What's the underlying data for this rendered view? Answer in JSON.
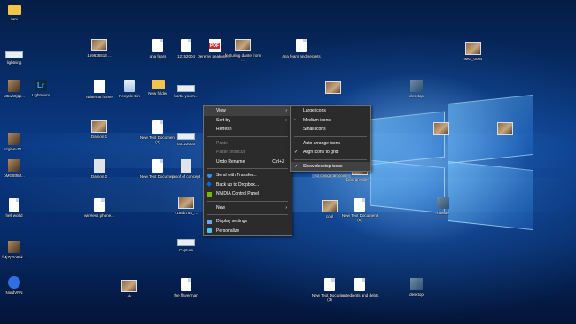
{
  "desktop": {
    "icons": [
      {
        "label": "funi",
        "kind": "folder"
      },
      {
        "label": "lightning",
        "kind": "strip"
      },
      {
        "label": "159635513 ...",
        "kind": "img"
      },
      {
        "label": "ana fears",
        "kind": "file"
      },
      {
        "label": "12152004",
        "kind": "file"
      },
      {
        "label": "Jeremy Leakone...",
        "kind": "pdf"
      },
      {
        "label": "featuring dante from ...",
        "kind": "img"
      },
      {
        "label": "ana fears and secrets",
        "kind": "file"
      },
      {
        "label": "IMG_0064",
        "kind": "img"
      },
      {
        "label": "ut5wh9jzp...",
        "kind": "photo"
      },
      {
        "label": "Lightroom",
        "kind": "lr"
      },
      {
        "label": "twitter at home",
        "kind": "doc"
      },
      {
        "label": "Recycle Bin",
        "kind": "bin"
      },
      {
        "label": "New folder",
        "kind": "folder"
      },
      {
        "label": "bortic yourn...",
        "kind": "strip"
      },
      {
        "label": "",
        "kind": "img"
      },
      {
        "label": "desktop",
        "kind": "box"
      },
      {
        "label": "ezgif-6-10...",
        "kind": "photo"
      },
      {
        "label": "Damon 1",
        "kind": "img"
      },
      {
        "label": "New Text Document (2)",
        "kind": "file"
      },
      {
        "label": "03122003",
        "kind": "strip"
      },
      {
        "label": "",
        "kind": "img"
      },
      {
        "label": "",
        "kind": "img"
      },
      {
        "label": "oMG8tfIM...",
        "kind": "photo"
      },
      {
        "label": "Damon 2",
        "kind": "gray"
      },
      {
        "label": "New Text Document",
        "kind": "file"
      },
      {
        "label": "proof of concept",
        "kind": "gray"
      },
      {
        "label": "so cosign amboise",
        "kind": "sel"
      },
      {
        "label": "bing aryoper ...",
        "kind": "img"
      },
      {
        "label": "hell world",
        "kind": "file"
      },
      {
        "label": "wireless phone...",
        "kind": "file"
      },
      {
        "label": "7165b784_...",
        "kind": "img"
      },
      {
        "label": "cool",
        "kind": "img"
      },
      {
        "label": "New Text Document (5)",
        "kind": "file"
      },
      {
        "label": "dtdsde",
        "kind": "box"
      },
      {
        "label": "fMjZp2o8ek...",
        "kind": "photo"
      },
      {
        "label": "Capture",
        "kind": "strip"
      },
      {
        "label": "NordVPN",
        "kind": "vpn"
      },
      {
        "label": "ok",
        "kind": "img"
      },
      {
        "label": "the flayerman",
        "kind": "file"
      },
      {
        "label": "New Text Document (3)",
        "kind": "file"
      },
      {
        "label": "ingredients and debts",
        "kind": "file"
      },
      {
        "label": "desktop",
        "kind": "box"
      }
    ]
  },
  "context_menu": {
    "view": "View",
    "sort_by": "Sort by",
    "refresh": "Refresh",
    "paste": "Paste",
    "paste_shortcut": "Paste shortcut",
    "undo_rename": "Undo Rename",
    "undo_shortcut": "Ctrl+Z",
    "send_with_transfer": "Send with Transfer...",
    "back_up_dropbox": "Back up to Dropbox...",
    "nvidia": "NVIDIA Control Panel",
    "new": "New",
    "display_settings": "Display settings",
    "personalize": "Personalize",
    "arrow": "›"
  },
  "view_submenu": {
    "large_icons": "Large icons",
    "medium_icons": "Medium icons",
    "small_icons": "Small icons",
    "auto_arrange": "Auto arrange icons",
    "align_grid": "Align icons to grid",
    "show_desktop": "Show desktop icons",
    "bullet": "•",
    "check": "✓"
  },
  "colors": {
    "menu_bg": "#2b2b2b",
    "menu_highlight": "#414141",
    "wallpaper": "#0a3a86"
  }
}
